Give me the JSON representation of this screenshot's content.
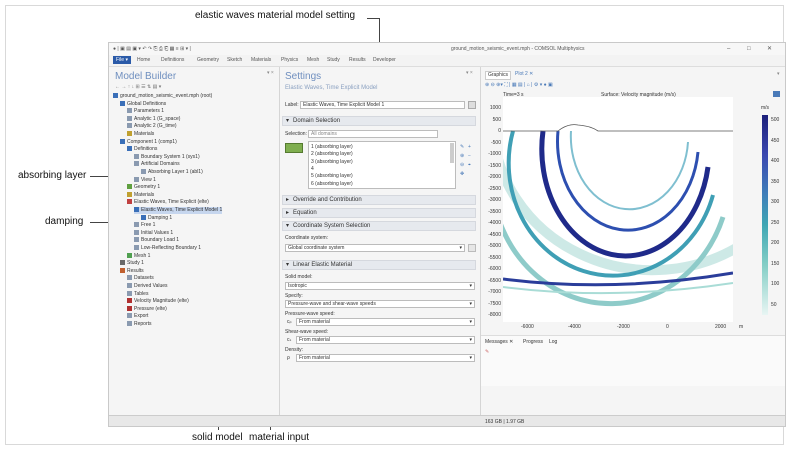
{
  "annotations": {
    "top": "elastic waves material model setting",
    "absorbing": "absorbing layer",
    "damping": "damping",
    "solid_model": "solid model",
    "material_input": "material input"
  },
  "window": {
    "title": "ground_motion_seismic_event.mph - COMSOL Multiphysics",
    "ribbon": [
      "Home",
      "Definitions",
      "Geometry",
      "Sketch",
      "Materials",
      "Physics",
      "Mesh",
      "Study",
      "Results",
      "Developer"
    ],
    "file_label": "File ▾",
    "win_controls": [
      "–",
      "□",
      "✕"
    ]
  },
  "model_builder": {
    "title": "Model Builder",
    "tree": [
      {
        "label": "ground_motion_seismic_event.mph (root)",
        "indent": 0,
        "icon": "root-icon"
      },
      {
        "label": "Global Definitions",
        "indent": 1,
        "icon": "globe-icon"
      },
      {
        "label": "Parameters 1",
        "indent": 2,
        "icon": "parameter-icon"
      },
      {
        "label": "Analytic 1 (G_space)",
        "indent": 2,
        "icon": "function-icon"
      },
      {
        "label": "Analytic 2 (G_time)",
        "indent": 2,
        "icon": "function-icon"
      },
      {
        "label": "Materials",
        "indent": 2,
        "icon": "materials-icon"
      },
      {
        "label": "Component 1 (comp1)",
        "indent": 1,
        "icon": "component-icon"
      },
      {
        "label": "Definitions",
        "indent": 2,
        "icon": "definitions-icon"
      },
      {
        "label": "Boundary System 1 (sys1)",
        "indent": 3,
        "icon": "system-icon"
      },
      {
        "label": "Artificial Domains",
        "indent": 3,
        "icon": "artificial-icon"
      },
      {
        "label": "Absorbing Layer 1 (abl1)",
        "indent": 4,
        "icon": "layer-icon"
      },
      {
        "label": "View 1",
        "indent": 3,
        "icon": "view-icon"
      },
      {
        "label": "Geometry 1",
        "indent": 2,
        "icon": "geometry-icon"
      },
      {
        "label": "Materials",
        "indent": 2,
        "icon": "materials-icon"
      },
      {
        "label": "Elastic Waves, Time Explicit (elte)",
        "indent": 2,
        "icon": "physics-icon"
      },
      {
        "label": "Elastic Waves, Time Explicit Model 1",
        "indent": 3,
        "icon": "model-icon"
      },
      {
        "label": "Damping 1",
        "indent": 4,
        "icon": "damping-icon"
      },
      {
        "label": "Free 1",
        "indent": 3,
        "icon": "free-icon"
      },
      {
        "label": "Initial Values 1",
        "indent": 3,
        "icon": "initial-icon"
      },
      {
        "label": "Boundary Load 1",
        "indent": 3,
        "icon": "load-icon"
      },
      {
        "label": "Low-Reflecting Boundary 1",
        "indent": 3,
        "icon": "boundary-icon"
      },
      {
        "label": "Mesh 1",
        "indent": 2,
        "icon": "mesh-icon"
      },
      {
        "label": "Study 1",
        "indent": 1,
        "icon": "study-icon"
      },
      {
        "label": "Results",
        "indent": 1,
        "icon": "results-icon"
      },
      {
        "label": "Datasets",
        "indent": 2,
        "icon": "dataset-icon"
      },
      {
        "label": "Derived Values",
        "indent": 2,
        "icon": "derived-icon"
      },
      {
        "label": "Tables",
        "indent": 2,
        "icon": "table-icon"
      },
      {
        "label": "Velocity Magnitude (elte)",
        "indent": 2,
        "icon": "plot-icon"
      },
      {
        "label": "Pressure (elte)",
        "indent": 2,
        "icon": "plot-icon"
      },
      {
        "label": "Export",
        "indent": 2,
        "icon": "export-icon"
      },
      {
        "label": "Reports",
        "indent": 2,
        "icon": "report-icon"
      }
    ]
  },
  "settings": {
    "title": "Settings",
    "subtitle": "Elastic Waves, Time Explicit Model",
    "label_caption": "Label:",
    "label_value": "Elastic Waves, Time Explicit Model 1",
    "domain_selection": "Domain Selection",
    "selection_caption": "Selection:",
    "selection_value": "All domains",
    "domains": [
      "1 (absorbing layer)",
      "2 (absorbing layer)",
      "3 (absorbing layer)",
      "4",
      "5 (absorbing layer)",
      "6 (absorbing layer)"
    ],
    "override": "Override and Contribution",
    "equation": "Equation",
    "coord_section": "Coordinate System Selection",
    "coord_caption": "Coordinate system:",
    "coord_value": "Global coordinate system",
    "lem_section": "Linear Elastic Material",
    "solid_caption": "Solid model:",
    "solid_value": "Isotropic",
    "specify_caption": "Specify:",
    "specify_value": "Pressure-wave and shear-wave speeds",
    "pws_caption": "Pressure-wave speed:",
    "pws_symbol": "cₚ",
    "pws_value": "From material",
    "sws_caption": "Shear-wave speed:",
    "sws_symbol": "cₛ",
    "sws_value": "From material",
    "density_caption": "Density:",
    "density_symbol": "ρ",
    "density_value": "From material"
  },
  "graphics": {
    "tabs": [
      "Graphics",
      "Plot 2 ✕"
    ],
    "time_label": "Time=3 s",
    "surface_label": "Surface: Velocity magnitude (m/s)",
    "colorbar_unit": "m/s",
    "colorbar_ticks": [
      "500",
      "450",
      "400",
      "350",
      "300",
      "250",
      "200",
      "150",
      "100",
      "50"
    ],
    "y_ticks": [
      "1000",
      "500",
      "0",
      "-500",
      "-1000",
      "-1500",
      "-2000",
      "-2500",
      "-3000",
      "-3500",
      "-4000",
      "-4500",
      "-5000",
      "-5500",
      "-6000",
      "-6500",
      "-7000",
      "-7500",
      "-8000"
    ],
    "x_ticks": [
      "-6000",
      "-4000",
      "-2000",
      "0",
      "2000"
    ],
    "x_unit": "m",
    "messages_tabs": [
      "Messages ✕",
      "Progress",
      "Log"
    ],
    "status": "163 GB | 1.97 GB"
  },
  "colors": {
    "wave_dark": "#1f2a8a",
    "wave_mid": "#3fa0b8",
    "wave_light": "#9bd6cf",
    "accent": "#2a5aa8"
  }
}
